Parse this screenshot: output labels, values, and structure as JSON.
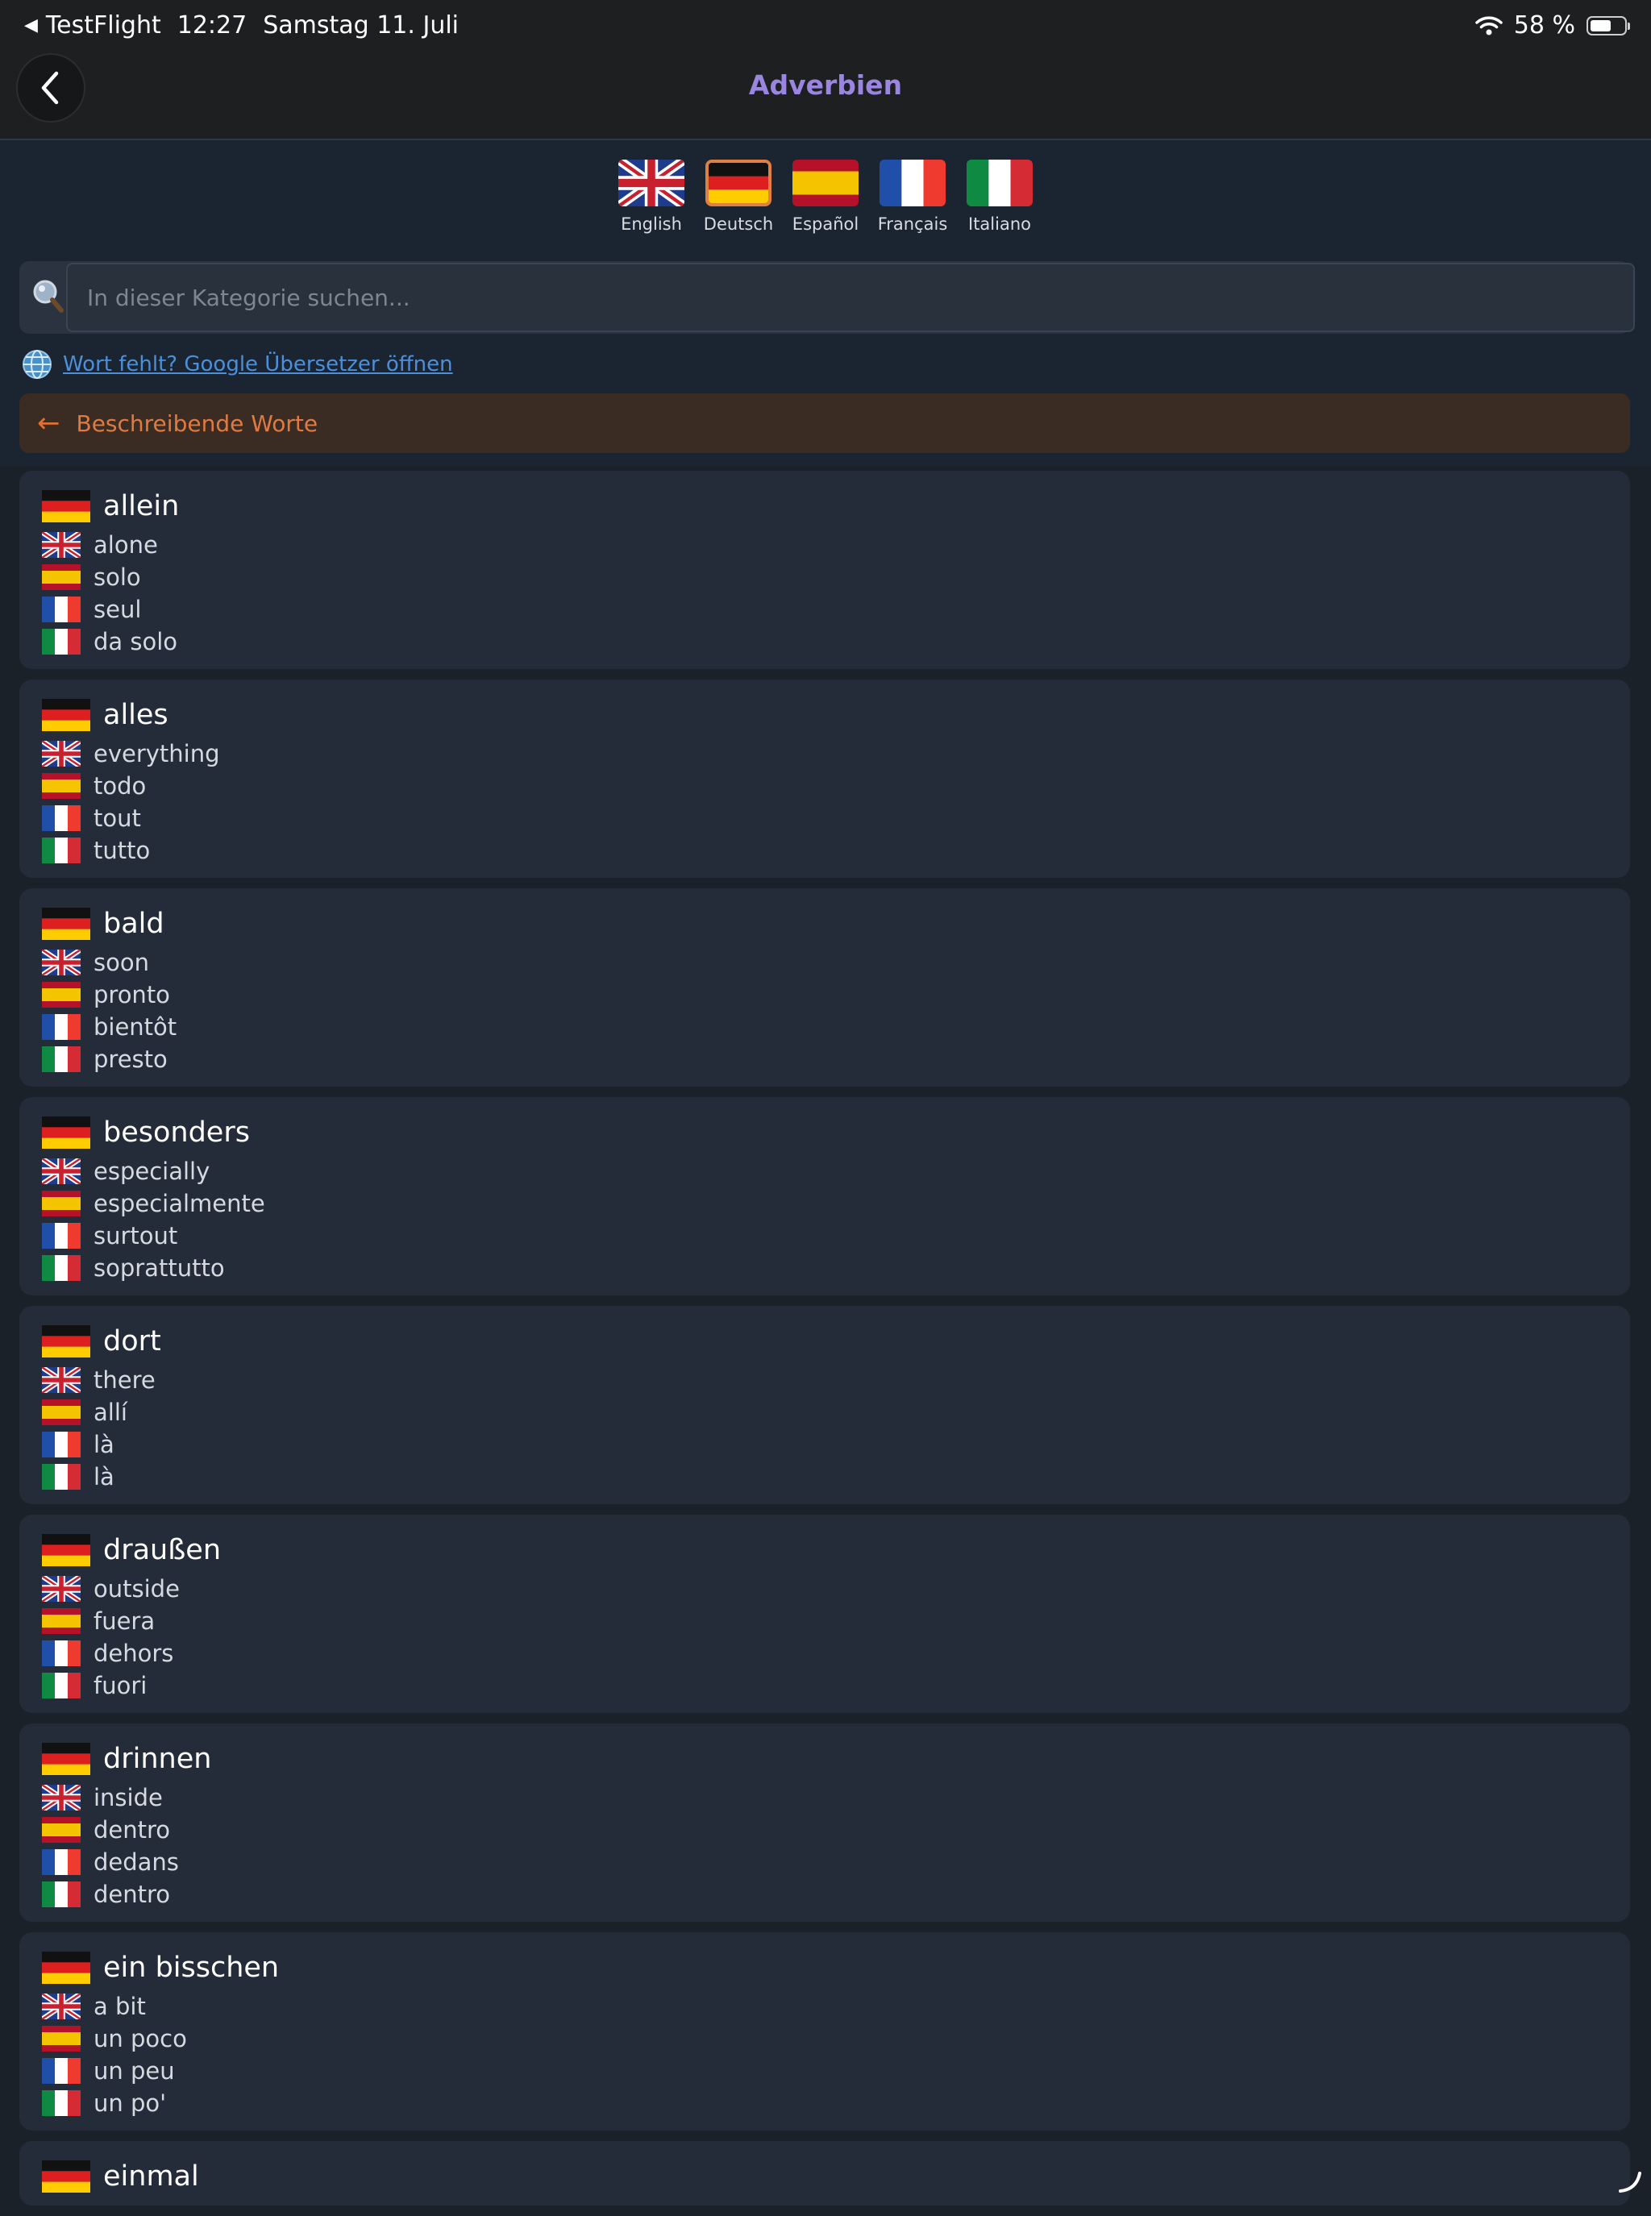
{
  "status_bar": {
    "back_app": "TestFlight",
    "time": "12:27",
    "date": "Samstag 11. Juli",
    "battery": "58 %",
    "battery_level": 0.58
  },
  "nav": {
    "title": "Adverbien"
  },
  "languages": [
    {
      "code": "en",
      "label": "English",
      "selected": false
    },
    {
      "code": "de",
      "label": "Deutsch",
      "selected": true
    },
    {
      "code": "es",
      "label": "Español",
      "selected": false
    },
    {
      "code": "fr",
      "label": "Français",
      "selected": false
    },
    {
      "code": "it",
      "label": "Italiano",
      "selected": false
    }
  ],
  "search": {
    "placeholder": "In dieser Kategorie suchen...",
    "value": ""
  },
  "google_link": "Wort fehlt? Google Übersetzer öffnen",
  "category_back": {
    "arrow": "←",
    "label": "Beschreibende Worte"
  },
  "colors": {
    "accent_title": "#9a86e0",
    "category_orange": "#e07a40",
    "link_blue": "#4d8fd8",
    "selected_flag_border": "#e08040"
  },
  "words": [
    {
      "de": "allein",
      "en": "alone",
      "es": "solo",
      "fr": "seul",
      "it": "da solo"
    },
    {
      "de": "alles",
      "en": "everything",
      "es": "todo",
      "fr": "tout",
      "it": "tutto"
    },
    {
      "de": "bald",
      "en": "soon",
      "es": "pronto",
      "fr": "bientôt",
      "it": "presto"
    },
    {
      "de": "besonders",
      "en": "especially",
      "es": "especialmente",
      "fr": "surtout",
      "it": "soprattutto"
    },
    {
      "de": "dort",
      "en": "there",
      "es": "allí",
      "fr": "là",
      "it": "là"
    },
    {
      "de": "draußen",
      "en": "outside",
      "es": "fuera",
      "fr": "dehors",
      "it": "fuori"
    },
    {
      "de": "drinnen",
      "en": "inside",
      "es": "dentro",
      "fr": "dedans",
      "it": "dentro"
    },
    {
      "de": "ein bisschen",
      "en": "a bit",
      "es": "un poco",
      "fr": "un peu",
      "it": "un po'"
    },
    {
      "de": "einmal"
    }
  ]
}
